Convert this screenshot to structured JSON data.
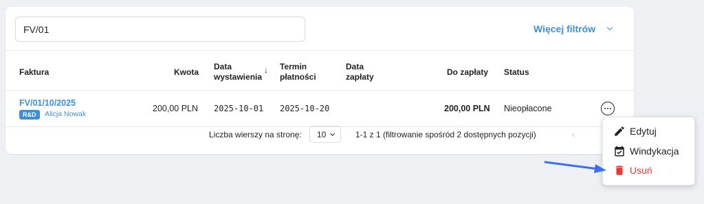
{
  "search": {
    "value": "FV/01"
  },
  "filters": {
    "more_label": "Więcej filtrów"
  },
  "table": {
    "headers": {
      "invoice": "Faktura",
      "amount": "Kwota",
      "issue_date_line1": "Data",
      "issue_date_line2": "wystawienia",
      "due_date_line1": "Termin",
      "due_date_line2": "płatności",
      "payment_date_line1": "Data",
      "payment_date_line2": "zapłaty",
      "to_pay": "Do zapłaty",
      "status": "Status"
    },
    "sort_indicator": "↓",
    "rows": [
      {
        "invoice_number": "FV/01/10/2025",
        "tag": "R&D",
        "person": "Alicja Nowak",
        "amount": "200,00 PLN",
        "issue_date": "2025-10-01",
        "due_date": "2025-10-20",
        "payment_date": "",
        "to_pay": "200,00 PLN",
        "status": "Nieopłacone"
      }
    ]
  },
  "pagination": {
    "rows_per_page_label": "Liczba wierszy na stronę:",
    "rows_per_page_value": "10",
    "info": "1-1 z 1 (filtrowanie spośród 2 dostępnych pozycji)",
    "prev_symbol": "‹"
  },
  "context_menu": {
    "items": [
      {
        "label": "Edytuj",
        "icon": "pencil-icon"
      },
      {
        "label": "Windykacja",
        "icon": "calendar-check-icon"
      },
      {
        "label": "Usuń",
        "icon": "trash-icon"
      }
    ],
    "delete_color": "#e53935"
  },
  "colors": {
    "accent": "#3d8fd1",
    "annotation_arrow": "#3a6ff0",
    "background": "#eef0f3"
  }
}
